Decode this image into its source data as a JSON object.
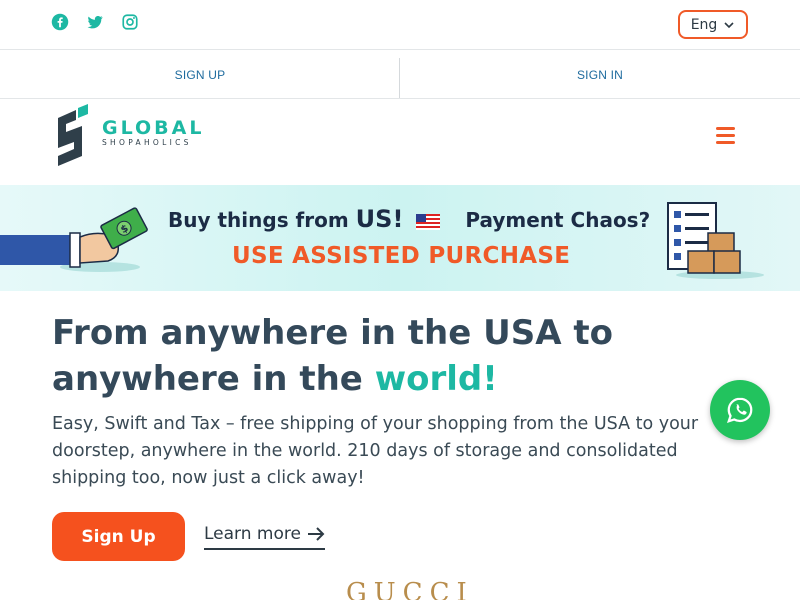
{
  "social": {
    "icons": [
      "facebook-icon",
      "twitter-icon",
      "instagram-icon"
    ],
    "color": "#1db8a3"
  },
  "language": {
    "selected": "Eng"
  },
  "auth": {
    "signup_label": "SIGN UP",
    "signin_label": "SIGN IN"
  },
  "brand": {
    "name": "GLOBAL",
    "tagline": "SHOPAHOLICS",
    "accent": "#1db8a3",
    "dark": "#2f3f4a"
  },
  "banner": {
    "line1_part1": "Buy things from",
    "line1_us": "US!",
    "line1_part2": "Payment Chaos?",
    "line2": "USE ASSISTED PURCHASE"
  },
  "hero": {
    "title_part1": "From anywhere in the USA to anywhere in the ",
    "title_highlight": "world!",
    "description": "Easy, Swift and Tax – free shipping of your shopping from the USA to your doorstep, anywhere in the world. 210 days of storage and consolidated shipping too, now just a click away!",
    "signup_button": "Sign Up",
    "learn_more": "Learn more"
  },
  "partner_logo": "GUCCI",
  "colors": {
    "primary_orange": "#f5511e",
    "teal": "#1db8a3",
    "whatsapp_green": "#22c35e"
  }
}
